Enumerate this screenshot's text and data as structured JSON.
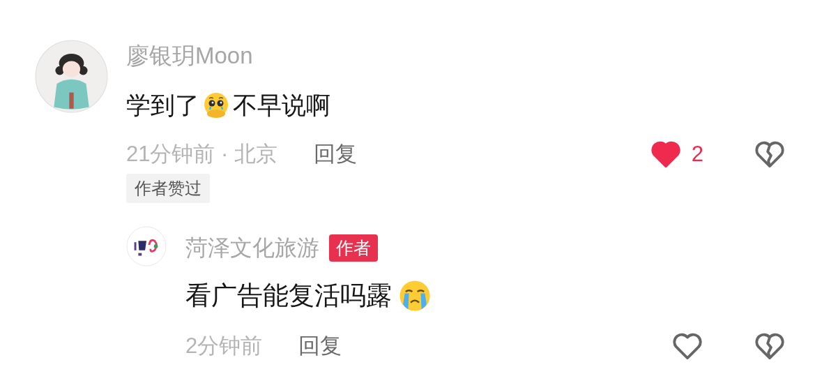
{
  "comments": [
    {
      "avatar": {
        "kind": "figure"
      },
      "username": "廖银玥Moon",
      "content": [
        {
          "kind": "text",
          "text": "学到了"
        },
        {
          "kind": "pleading-emoji"
        },
        {
          "kind": "text",
          "text": "不早说啊"
        }
      ],
      "time": "21分钟前 · 北京",
      "reply_label": "回复",
      "liked": true,
      "like_count": "2",
      "tag": "作者赞过",
      "replies": [
        {
          "avatar": {
            "kind": "logo"
          },
          "username": "菏泽文化旅游",
          "badge": "作者",
          "content": [
            {
              "kind": "text",
              "text": "看广告能复活吗露"
            },
            {
              "kind": "crying-emoji"
            }
          ],
          "time": "2分钟前",
          "reply_label": "回复",
          "liked": false
        }
      ]
    }
  ]
}
